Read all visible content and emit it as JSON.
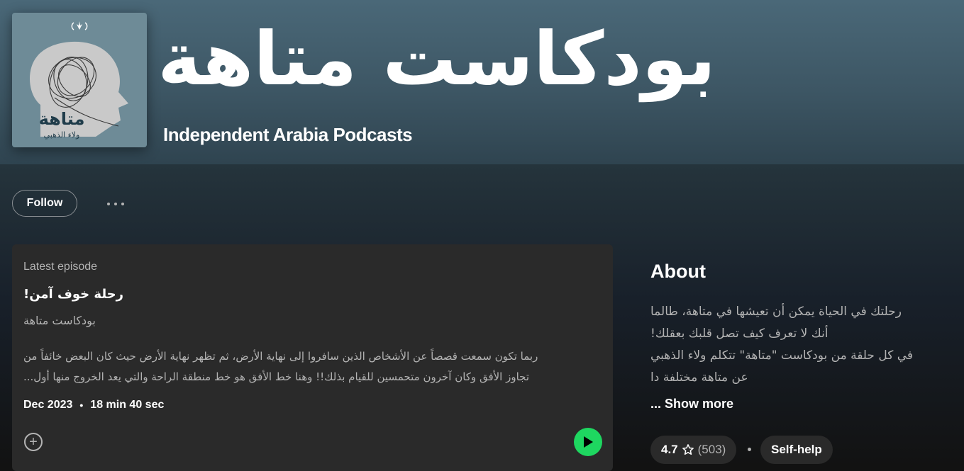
{
  "header": {
    "title": "بودكاست متاهة",
    "publisher": "Independent Arabia Podcasts",
    "cover": {
      "title_ar": "متاهة",
      "host_ar": "ولاء الذهبي"
    }
  },
  "actions": {
    "follow_label": "Follow",
    "more_icon": "more-options-icon"
  },
  "latest_episode": {
    "label": "Latest episode",
    "title": "رحلة خوف آمن!",
    "show": "بودكاست متاهة",
    "description_lines": [
      "ربما تكون سمعت قصصاً عن الأشخاص الذين سافروا إلى نهاية الأرض، ثم تظهر نهاية الأرض حيث كان البعض خائفاً من",
      "تجاوز الأفق وكان آخرون متحمسين للقيام بذلك!! وهنا خط الأفق هو خط منطقة الراحة والتي يعد الخروج منها أول..."
    ],
    "date": "Dec 2023",
    "duration": "18 min 40 sec",
    "play_color": "#1ed760"
  },
  "about": {
    "heading": "About",
    "lines": [
      "رحلتك في الحياة يمكن أن تعيشها في متاهة، طالما",
      "أنك لا تعرف كيف تصل قلبك بعقلك!",
      "في كل حلقة من بودكاست \"متاهة\" تتكلم ولاء الذهبي",
      "عن متاهة مختلفة دا"
    ],
    "show_more": "... Show more",
    "rating": "4.7",
    "rating_count": "(503)",
    "category": "Self-help"
  }
}
